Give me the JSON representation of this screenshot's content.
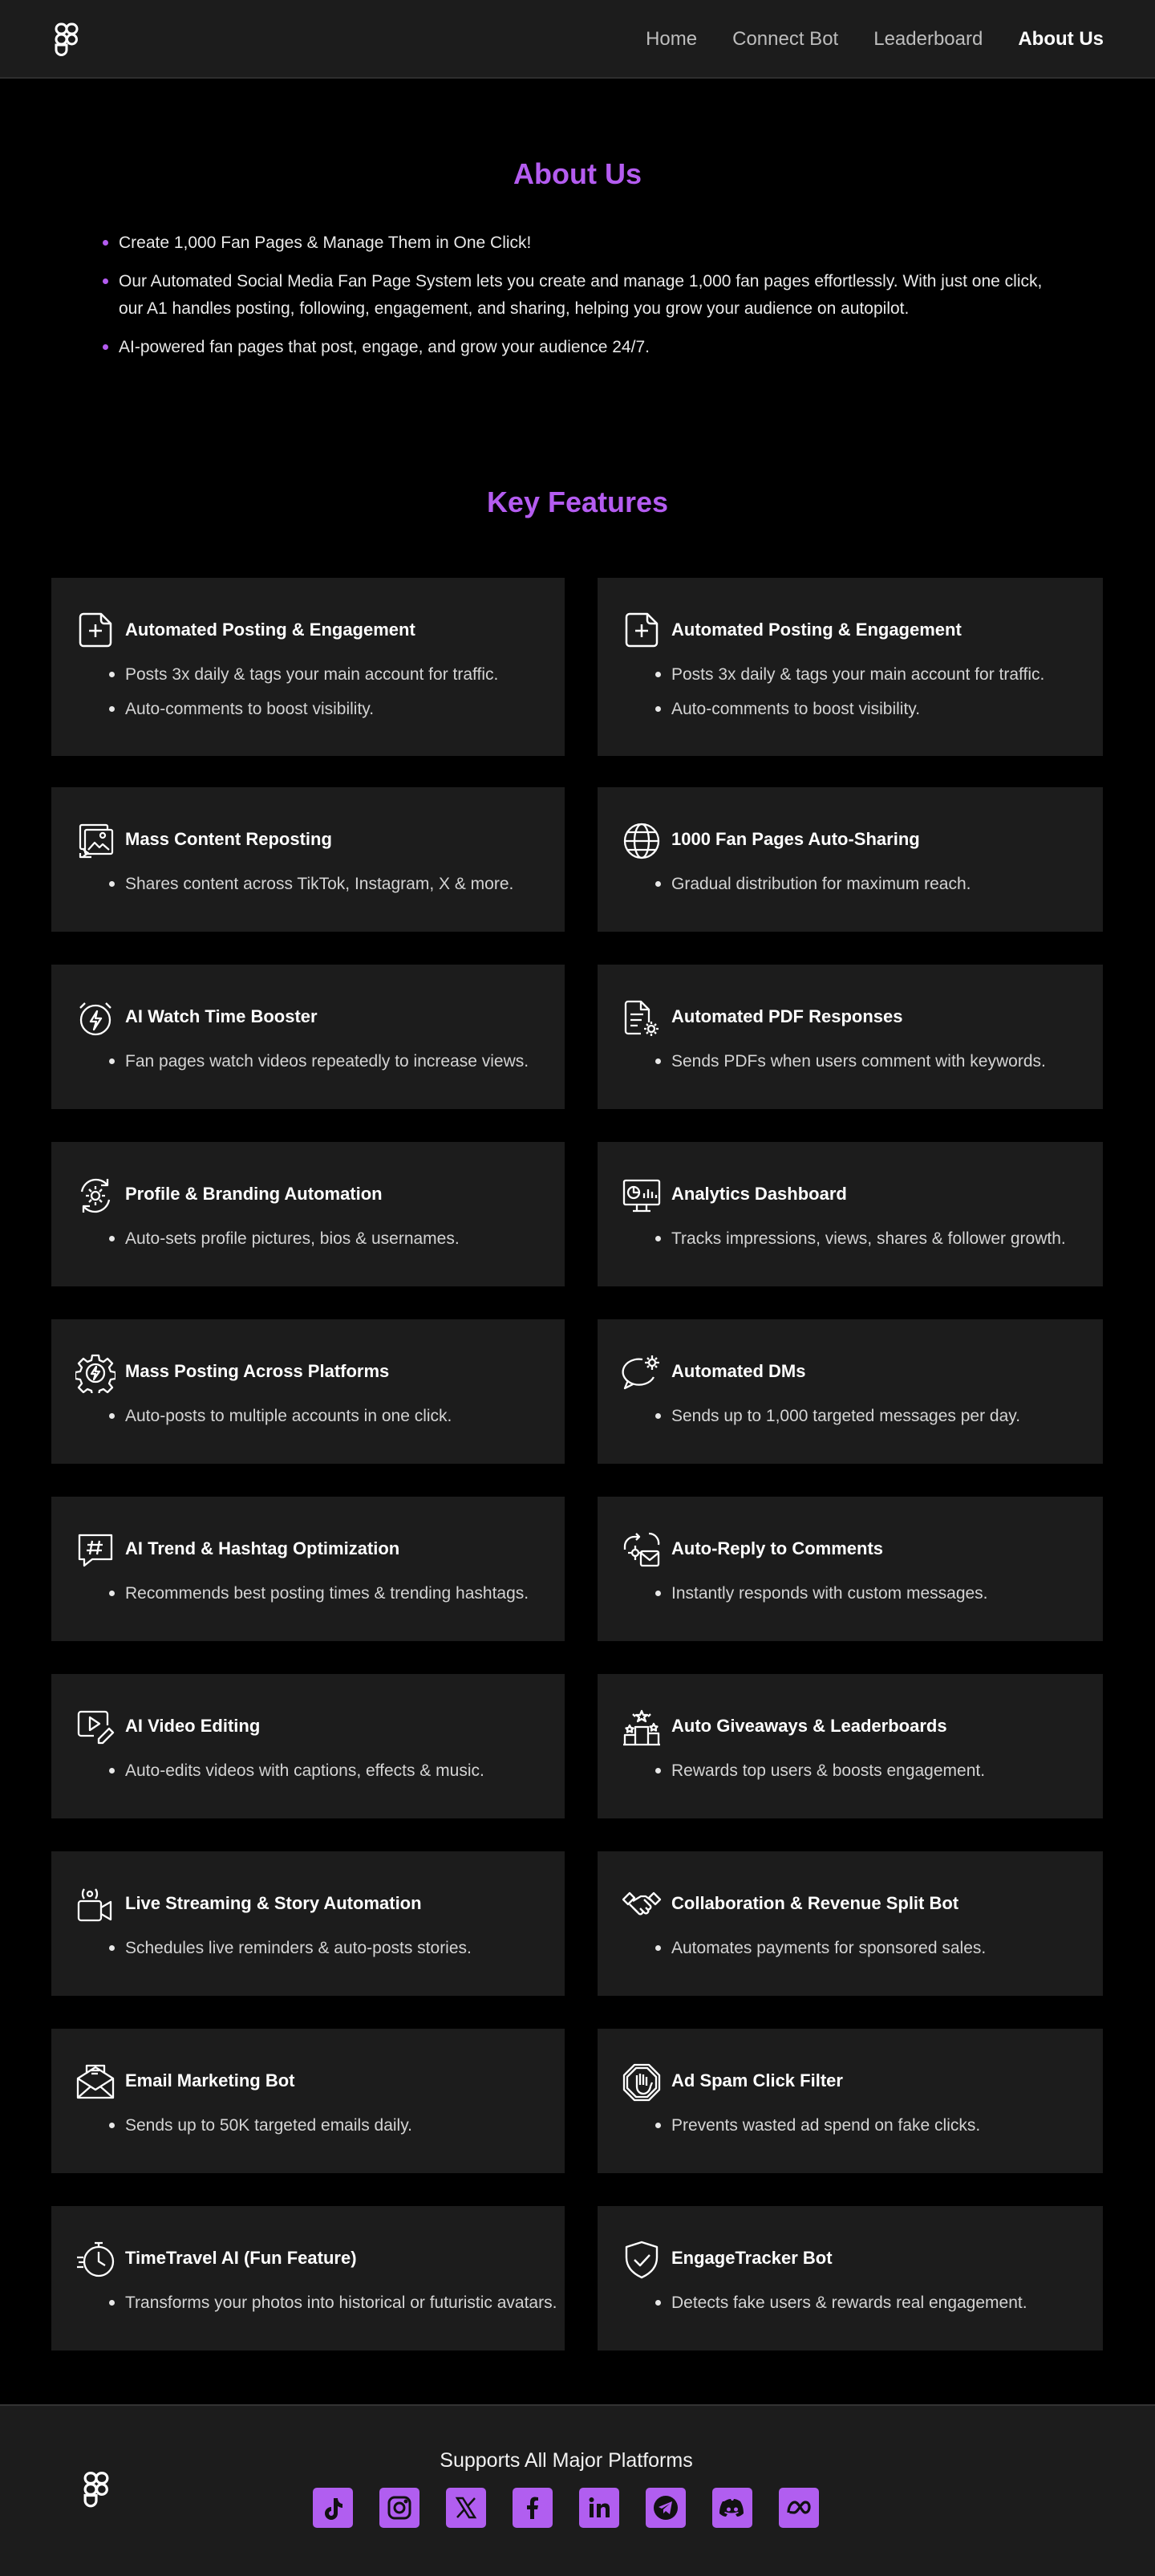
{
  "nav": {
    "items": [
      {
        "label": "Home",
        "active": false
      },
      {
        "label": "Connect Bot",
        "active": false
      },
      {
        "label": "Leaderboard",
        "active": false
      },
      {
        "label": "About Us",
        "active": true
      }
    ]
  },
  "about": {
    "title": "About Us",
    "points": [
      "Create 1,000 Fan Pages & Manage Them in One Click!",
      "Our Automated Social Media Fan Page System lets you create and manage 1,000 fan pages effortlessly. With just one click, our A1 handles posting, following, engagement, and sharing, helping you grow your audience on autopilot.",
      "AI-powered fan pages that post, engage, and grow your audience 24/7."
    ]
  },
  "features": {
    "title": "Key Features",
    "items": [
      {
        "title": "Automated Posting & Engagement",
        "icon": "plus-doc-icon",
        "bullets": [
          "Posts 3x daily & tags your main account for traffic.",
          "Auto-comments to boost visibility."
        ]
      },
      {
        "title": "Automated Posting & Engagement",
        "icon": "plus-doc-icon",
        "bullets": [
          "Posts 3x daily & tags your main account for traffic.",
          "Auto-comments to boost visibility."
        ]
      },
      {
        "title": "Mass Content Reposting",
        "icon": "media-stack-icon",
        "bullets": [
          "Shares content across TikTok, Instagram, X & more."
        ]
      },
      {
        "title": "1000 Fan Pages Auto-Sharing",
        "icon": "globe-icon",
        "bullets": [
          "Gradual distribution for maximum reach."
        ]
      },
      {
        "title": "AI Watch Time Booster",
        "icon": "stopwatch-bolt-icon",
        "bullets": [
          "Fan pages watch videos repeatedly to increase views."
        ]
      },
      {
        "title": "Automated PDF Responses",
        "icon": "document-gear-icon",
        "bullets": [
          "Sends PDFs when users comment with keywords."
        ]
      },
      {
        "title": "Profile & Branding Automation",
        "icon": "cycle-gear-icon",
        "bullets": [
          "Auto-sets profile pictures, bios & usernames."
        ]
      },
      {
        "title": "Analytics Dashboard",
        "icon": "monitor-chart-icon",
        "bullets": [
          "Tracks impressions, views, shares & follower growth."
        ]
      },
      {
        "title": "Mass Posting Across Platforms",
        "icon": "gear-bolt-icon",
        "bullets": [
          "Auto-posts to multiple accounts in one click."
        ]
      },
      {
        "title": "Automated DMs",
        "icon": "chat-gear-icon",
        "bullets": [
          "Sends up to 1,000 targeted messages per day."
        ]
      },
      {
        "title": "AI Trend & Hashtag Optimization",
        "icon": "hashtag-bubble-icon",
        "bullets": [
          "Recommends best posting times & trending hashtags."
        ]
      },
      {
        "title": "Auto-Reply to Comments",
        "icon": "reply-envelope-icon",
        "bullets": [
          "Instantly responds with custom messages."
        ]
      },
      {
        "title": "AI Video Editing",
        "icon": "video-edit-icon",
        "bullets": [
          "Auto-edits videos with captions, effects & music."
        ]
      },
      {
        "title": "Auto Giveaways & Leaderboards",
        "icon": "podium-icon",
        "bullets": [
          "Rewards top users & boosts engagement."
        ]
      },
      {
        "title": "Live Streaming & Story Automation",
        "icon": "live-camera-icon",
        "bullets": [
          "Schedules live reminders & auto-posts stories."
        ]
      },
      {
        "title": "Collaboration & Revenue Split Bot",
        "icon": "handshake-icon",
        "bullets": [
          "Automates payments for sponsored sales."
        ]
      },
      {
        "title": "Email Marketing Bot",
        "icon": "email-icon",
        "bullets": [
          "Sends up to 50K targeted emails daily."
        ]
      },
      {
        "title": "Ad Spam Click Filter",
        "icon": "stop-hand-icon",
        "bullets": [
          "Prevents wasted ad spend on fake clicks."
        ]
      },
      {
        "title": "TimeTravel AI (Fun Feature)",
        "icon": "fast-clock-icon",
        "bullets": [
          "Transforms your photos into historical or futuristic avatars."
        ]
      },
      {
        "title": "EngageTracker Bot",
        "icon": "shield-check-icon",
        "bullets": [
          "Detects fake users & rewards real engagement."
        ]
      }
    ]
  },
  "footer": {
    "supports": "Supports All Major Platforms",
    "platforms": [
      "tiktok-icon",
      "instagram-icon",
      "x-icon",
      "facebook-icon",
      "linkedin-icon",
      "telegram-icon",
      "discord-icon",
      "meta-icon"
    ]
  },
  "colors": {
    "accent": "#b45cf0",
    "card": "#1c1c1c",
    "background": "#000000"
  }
}
